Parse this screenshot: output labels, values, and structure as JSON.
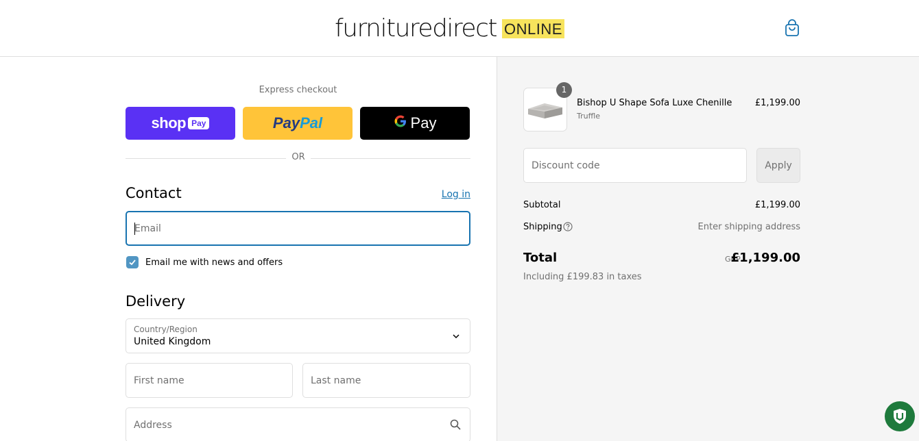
{
  "header": {
    "logo_text": "furnituredirect",
    "logo_badge": "ONLINE",
    "cart_icon": "shopping-bag-icon"
  },
  "express": {
    "title": "Express checkout",
    "shop_pay": {
      "word": "shop",
      "pill": "Pay"
    },
    "paypal": {
      "part1": "Pay",
      "part2": "Pal"
    },
    "gpay": {
      "g": "G",
      "word": "Pay"
    },
    "or_text": "OR"
  },
  "contact": {
    "title": "Contact",
    "login_label": "Log in",
    "email_placeholder": "Email",
    "newsletter_label": "Email me with news and offers",
    "newsletter_checked": true
  },
  "delivery": {
    "title": "Delivery",
    "country_label": "Country/Region",
    "country_value": "United Kingdom",
    "first_name_placeholder": "First name",
    "last_name_placeholder": "Last name",
    "address_placeholder": "Address"
  },
  "summary": {
    "item": {
      "quantity": "1",
      "name": "Bishop U Shape Sofa Luxe Chenille",
      "variant": "Truffle",
      "price": "£1,199.00"
    },
    "discount_placeholder": "Discount code",
    "apply_label": "Apply",
    "subtotal_label": "Subtotal",
    "subtotal_value": "£1,199.00",
    "shipping_label": "Shipping",
    "shipping_value": "Enter shipping address",
    "total_label": "Total",
    "currency": "GBP",
    "total_value": "£1,199.00",
    "tax_note": "Including £199.83 in taxes"
  },
  "colors": {
    "accent": "#1773b0",
    "shop_pay": "#5a31f4",
    "paypal": "#ffc439",
    "logo_highlight": "#f7e35c"
  }
}
